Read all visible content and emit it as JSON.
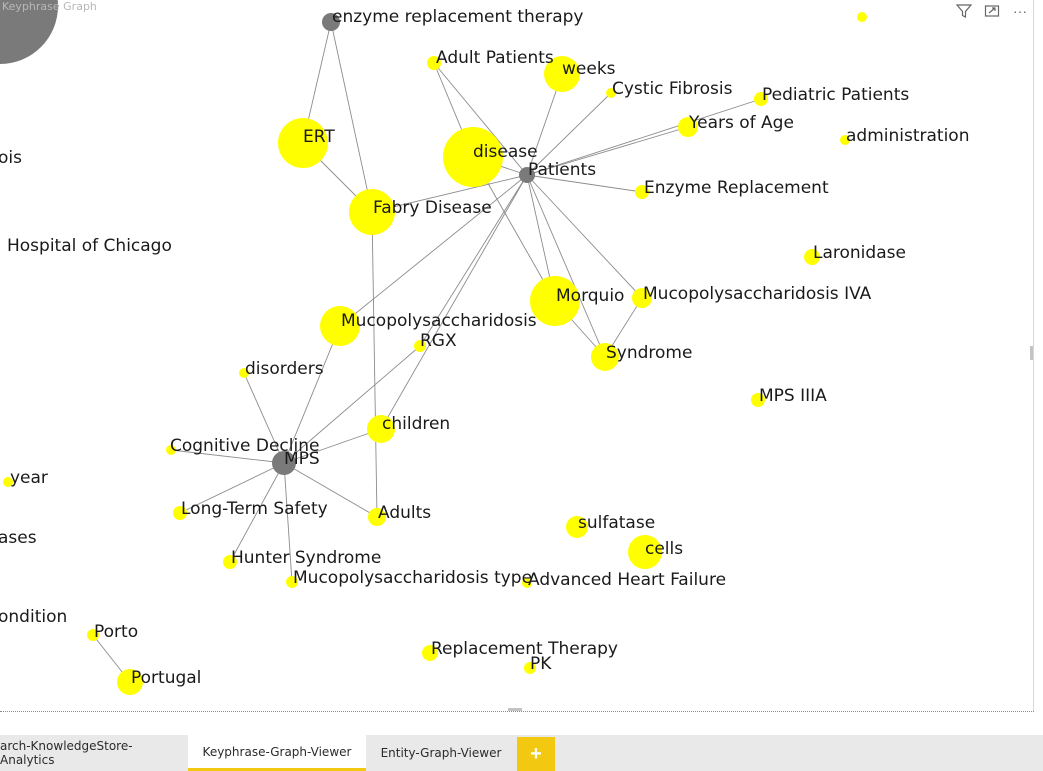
{
  "visual": {
    "title": "Keyphrase Graph",
    "header_icons": [
      "filter-icon",
      "focus-mode-icon",
      "more-options-icon"
    ],
    "more_label": "···"
  },
  "colors": {
    "keyphrase": "#ffff00",
    "entity": "#7a7a7a",
    "edge": "#8c8c8c",
    "accent": "#f2c811"
  },
  "graph": {
    "nodes": [
      {
        "id": "n_corner",
        "label": "",
        "type": "entity"
      },
      {
        "id": "n_ert_therapy",
        "label": "enzyme replacement therapy",
        "type": "entity"
      },
      {
        "id": "n_topright",
        "label": "",
        "type": "keyphrase"
      },
      {
        "id": "n_adult_patients",
        "label": "Adult Patients",
        "type": "keyphrase"
      },
      {
        "id": "n_weeks",
        "label": "weeks",
        "type": "keyphrase"
      },
      {
        "id": "n_cystic",
        "label": "Cystic Fibrosis",
        "type": "keyphrase"
      },
      {
        "id": "n_pediatric",
        "label": "Pediatric Patients",
        "type": "keyphrase"
      },
      {
        "id": "n_years",
        "label": "Years of Age",
        "type": "keyphrase"
      },
      {
        "id": "n_admin",
        "label": "administration",
        "type": "keyphrase"
      },
      {
        "id": "n_ert",
        "label": "ERT",
        "type": "keyphrase"
      },
      {
        "id": "n_disease",
        "label": "disease",
        "type": "keyphrase"
      },
      {
        "id": "n_patients",
        "label": "Patients",
        "type": "entity"
      },
      {
        "id": "n_osis",
        "label": "ois",
        "type": "keyphrase"
      },
      {
        "id": "n_enzyme_repl",
        "label": "Enzyme Replacement",
        "type": "keyphrase"
      },
      {
        "id": "n_fabry",
        "label": "Fabry Disease",
        "type": "keyphrase"
      },
      {
        "id": "n_hospital",
        "label": "Hospital of Chicago",
        "type": "keyphrase"
      },
      {
        "id": "n_laronidase",
        "label": "Laronidase",
        "type": "keyphrase"
      },
      {
        "id": "n_morquio",
        "label": "Morquio",
        "type": "keyphrase"
      },
      {
        "id": "n_mps_iva",
        "label": "Mucopolysaccharidosis IVA",
        "type": "keyphrase"
      },
      {
        "id": "n_mucopoly",
        "label": "Mucopolysaccharidosis",
        "type": "keyphrase"
      },
      {
        "id": "n_rgx",
        "label": "RGX",
        "type": "keyphrase"
      },
      {
        "id": "n_syndrome",
        "label": "Syndrome",
        "type": "keyphrase"
      },
      {
        "id": "n_disorders",
        "label": "disorders",
        "type": "keyphrase"
      },
      {
        "id": "n_mps_iiia",
        "label": "MPS IIIA",
        "type": "keyphrase"
      },
      {
        "id": "n_children",
        "label": "children",
        "type": "keyphrase"
      },
      {
        "id": "n_cognitive",
        "label": "Cognitive Decline",
        "type": "keyphrase"
      },
      {
        "id": "n_mps",
        "label": "MPS",
        "type": "entity"
      },
      {
        "id": "n_year",
        "label": "year",
        "type": "keyphrase"
      },
      {
        "id": "n_longterm",
        "label": "Long-Term Safety",
        "type": "keyphrase"
      },
      {
        "id": "n_adults",
        "label": "Adults",
        "type": "keyphrase"
      },
      {
        "id": "n_sulfatase",
        "label": "sulfatase",
        "type": "keyphrase"
      },
      {
        "id": "n_ases",
        "label": "ases",
        "type": "keyphrase"
      },
      {
        "id": "n_cells",
        "label": "cells",
        "type": "keyphrase"
      },
      {
        "id": "n_hunter",
        "label": "Hunter Syndrome",
        "type": "keyphrase"
      },
      {
        "id": "n_mps_type",
        "label": "Mucopolysaccharidosis type",
        "type": "keyphrase"
      },
      {
        "id": "n_ahf",
        "label": "Advanced Heart Failure",
        "type": "keyphrase"
      },
      {
        "id": "n_condition",
        "label": "ondition",
        "type": "keyphrase"
      },
      {
        "id": "n_porto",
        "label": "Porto",
        "type": "keyphrase"
      },
      {
        "id": "n_replacement",
        "label": "Replacement Therapy",
        "type": "keyphrase"
      },
      {
        "id": "n_pk",
        "label": "PK",
        "type": "keyphrase"
      },
      {
        "id": "n_portugal",
        "label": "Portugal",
        "type": "keyphrase"
      }
    ],
    "edges": [
      [
        "n_ert_therapy",
        "n_ert"
      ],
      [
        "n_ert_therapy",
        "n_fabry"
      ],
      [
        "n_ert",
        "n_fabry"
      ],
      [
        "n_patients",
        "n_adult_patients"
      ],
      [
        "n_patients",
        "n_weeks"
      ],
      [
        "n_patients",
        "n_cystic"
      ],
      [
        "n_patients",
        "n_pediatric"
      ],
      [
        "n_patients",
        "n_years"
      ],
      [
        "n_patients",
        "n_enzyme_repl"
      ],
      [
        "n_patients",
        "n_disease"
      ],
      [
        "n_patients",
        "n_fabry"
      ],
      [
        "n_patients",
        "n_morquio"
      ],
      [
        "n_patients",
        "n_mps_iva"
      ],
      [
        "n_patients",
        "n_syndrome"
      ],
      [
        "n_patients",
        "n_mucopoly"
      ],
      [
        "n_patients",
        "n_rgx"
      ],
      [
        "n_patients",
        "n_children"
      ],
      [
        "n_disease",
        "n_adult_patients"
      ],
      [
        "n_disease",
        "n_morquio"
      ],
      [
        "n_morquio",
        "n_syndrome"
      ],
      [
        "n_mps_iva",
        "n_syndrome"
      ],
      [
        "n_fabry",
        "n_adults"
      ],
      [
        "n_mps",
        "n_cognitive"
      ],
      [
        "n_mps",
        "n_longterm"
      ],
      [
        "n_mps",
        "n_hunter"
      ],
      [
        "n_mps",
        "n_mps_type"
      ],
      [
        "n_mps",
        "n_adults"
      ],
      [
        "n_mps",
        "n_children"
      ],
      [
        "n_mps",
        "n_disorders"
      ],
      [
        "n_mps",
        "n_mucopoly"
      ],
      [
        "n_mps",
        "n_rgx"
      ],
      [
        "n_porto",
        "n_portugal"
      ]
    ]
  },
  "tabs": [
    {
      "label": "arch-KnowledgeStore-Analytics",
      "active": false
    },
    {
      "label": "Keyphrase-Graph-Viewer",
      "active": true
    },
    {
      "label": "Entity-Graph-Viewer",
      "active": false
    }
  ],
  "add_page_label": "+"
}
